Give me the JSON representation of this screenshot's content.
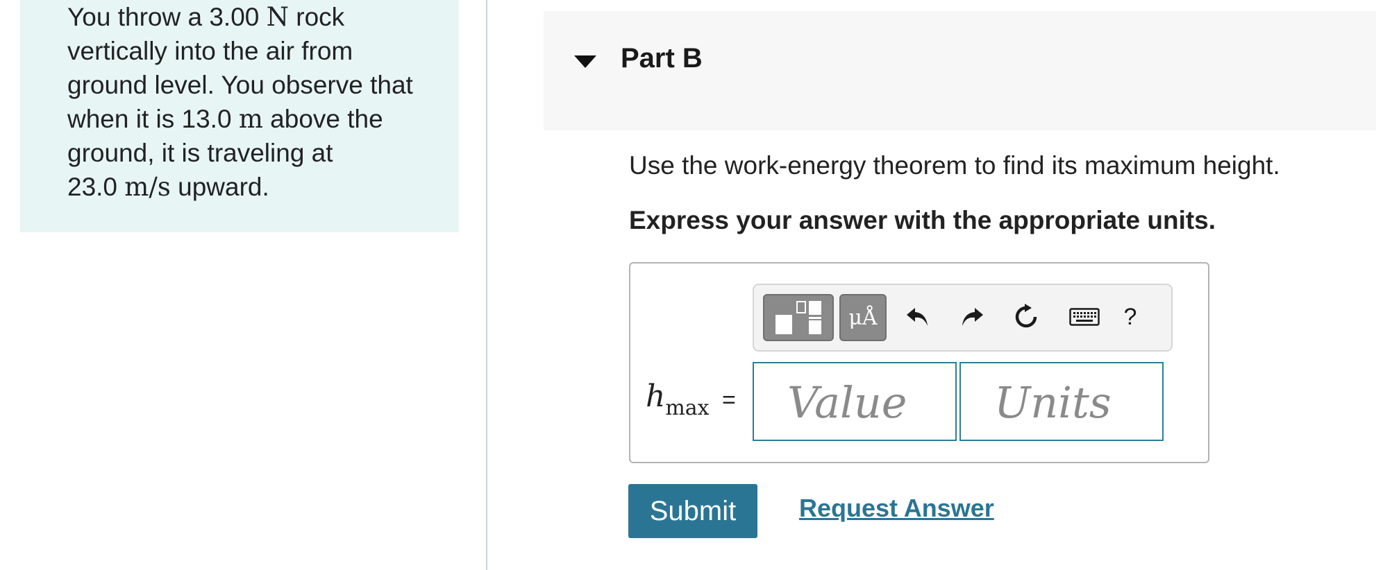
{
  "problem": {
    "line1_pre": "You throw a 3.00 ",
    "line1_unit": "N",
    "line1_post": " rock",
    "line2": "vertically into the air from",
    "line3": "ground level. You observe that",
    "line4_pre": "when it is 13.0 ",
    "line4_unit": "m",
    "line4_post": " above the",
    "line5": "ground, it is traveling at",
    "line6_pre": "23.0 ",
    "line6_unit": "m/s",
    "line6_post": " upward."
  },
  "part": {
    "title": "Part B",
    "instruction": "Use the work-energy theorem to find its maximum height.",
    "instruction_bold": "Express your answer with the appropriate units."
  },
  "toolbar": {
    "templates_icon": "templates-icon",
    "units_label": "μÅ",
    "undo_icon": "undo-icon",
    "redo_icon": "redo-icon",
    "reset_icon": "reset-icon",
    "keyboard_icon": "keyboard-icon",
    "help_label": "?"
  },
  "answer": {
    "variable": "h",
    "variable_sub": "max",
    "equals": "=",
    "value_placeholder": "Value",
    "units_placeholder": "Units"
  },
  "actions": {
    "submit_label": "Submit",
    "request_answer_label": "Request Answer"
  },
  "colors": {
    "panel_bg": "#e7f5f5",
    "accent": "#2b7594",
    "header_bg": "#f7f7f7"
  }
}
